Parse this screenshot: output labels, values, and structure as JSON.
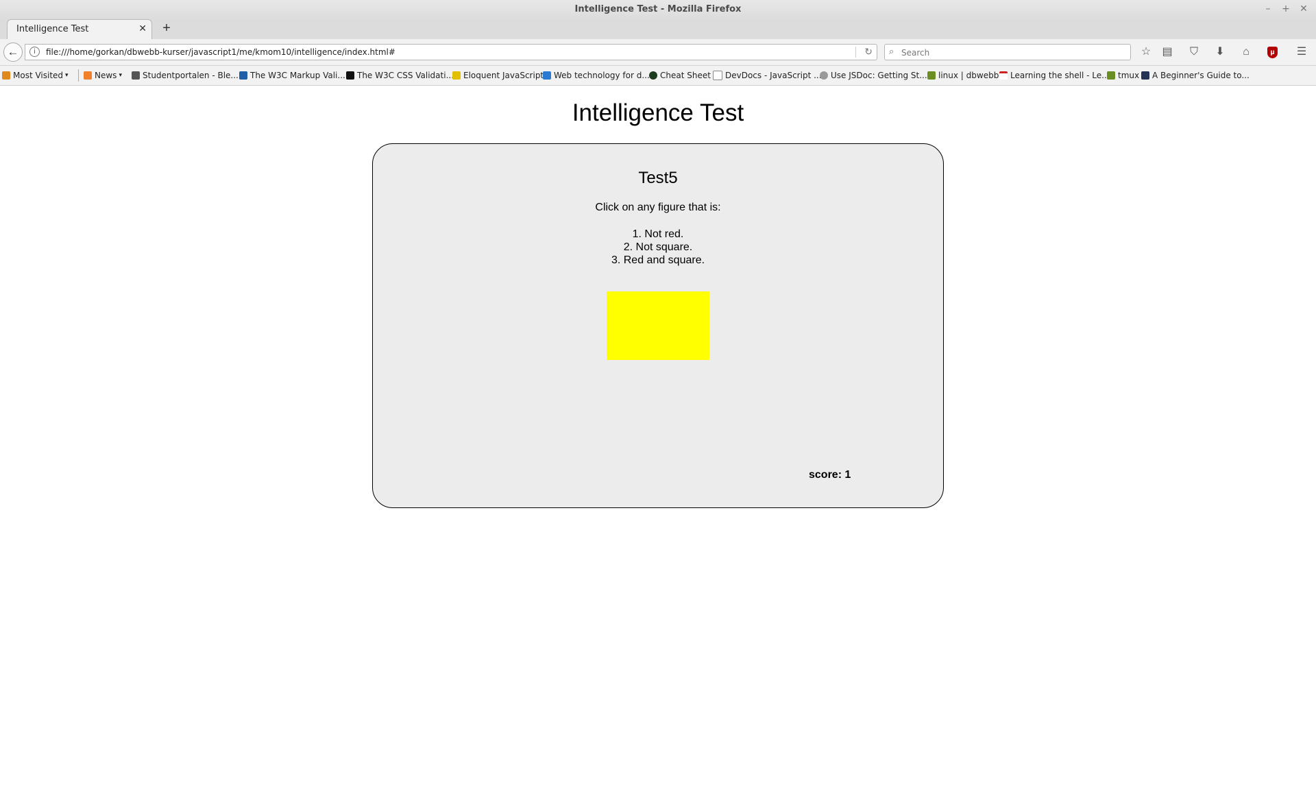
{
  "window": {
    "title": "Intelligence Test - Mozilla Firefox",
    "controls": {
      "minimize": "–",
      "maximize": "+",
      "close": "✕"
    }
  },
  "tabs": [
    {
      "label": "Intelligence Test",
      "close": "✕"
    }
  ],
  "new_tab": "+",
  "navbar": {
    "back": "←",
    "url": "file:///home/gorkan/dbwebb-kurser/javascript1/me/kmom10/intelligence/index.html#",
    "info": "i",
    "reload": "↻",
    "search_placeholder": "Search",
    "icons": {
      "bookmark_star": "☆",
      "reading_list": "▤",
      "pocket": "⛉",
      "downloads": "⬇",
      "home": "⌂",
      "ublock": "μ",
      "menu": "☰"
    }
  },
  "bookmarks": [
    {
      "label": "Most Visited",
      "caret": "▾",
      "color": "#e08a1e"
    },
    {
      "label": "News",
      "caret": "▾",
      "color": "#f0802a"
    },
    {
      "label": "Studentportalen - Ble...",
      "color": "#555555"
    },
    {
      "label": "The W3C Markup Vali...",
      "color": "#1f5fa8"
    },
    {
      "label": "The W3C CSS Validati...",
      "color": "#111111"
    },
    {
      "label": "Eloquent JavaScript",
      "color": "#e0c000"
    },
    {
      "label": "Web technology for d...",
      "color": "#2a7ad4"
    },
    {
      "label": "Cheat Sheet",
      "color": "#1d3b1d"
    },
    {
      "label": "DevDocs - JavaScript ...",
      "color": "#888888"
    },
    {
      "label": "Use JSDoc: Getting St...",
      "color": "#999999"
    },
    {
      "label": "linux | dbwebb",
      "color": "#6b8e23"
    },
    {
      "label": "Learning the shell - Le...",
      "color": "#cc2222"
    },
    {
      "label": "tmux",
      "color": "#6b8e23"
    },
    {
      "label": "A Beginner's Guide to...",
      "color": "#223355"
    }
  ],
  "page": {
    "heading": "Intelligence Test",
    "test_title": "Test5",
    "instruction": "Click on any figure that is:",
    "rules": [
      "1. Not red.",
      "2. Not square.",
      "3. Red and square."
    ],
    "figure": {
      "color": "#ffff00",
      "shape": "rectangle"
    },
    "score": "score: 1"
  }
}
